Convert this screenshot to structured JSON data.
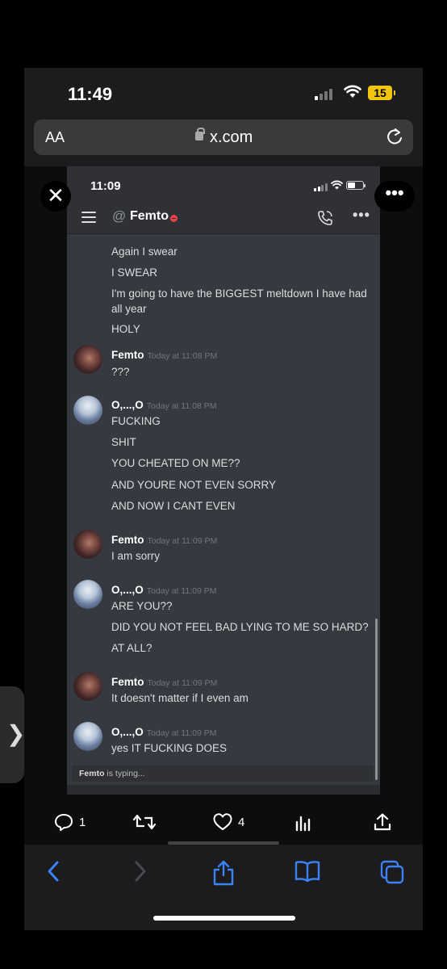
{
  "outer_status": {
    "time": "11:49",
    "battery": "15"
  },
  "browser": {
    "aa_label": "AA",
    "url": "x.com"
  },
  "discord": {
    "status_time": "11:09",
    "header_at": "@",
    "channel_name": "Femto",
    "messages": [
      {
        "type": "cont",
        "text": "Again I swear"
      },
      {
        "type": "cont",
        "text": "I SWEAR"
      },
      {
        "type": "cont",
        "text": "I'm going to have the BIGGEST meltdown I have had all year"
      },
      {
        "type": "cont",
        "text": "HOLY"
      },
      {
        "type": "head",
        "author": "Femto",
        "timestamp": "Today at 11:08 PM",
        "text": "???"
      },
      {
        "type": "head",
        "author": "O,...,O",
        "timestamp": "Today at 11:08 PM",
        "text": "FUCKING"
      },
      {
        "type": "cont",
        "text": "SHIT"
      },
      {
        "type": "cont",
        "text": "YOU CHEATED ON ME??"
      },
      {
        "type": "cont",
        "text": "AND YOURE NOT EVEN SORRY"
      },
      {
        "type": "cont",
        "text": "AND NOW I CANT EVEN"
      },
      {
        "type": "head",
        "author": "Femto",
        "timestamp": "Today at 11:09 PM",
        "text": "I am sorry"
      },
      {
        "type": "head",
        "author": "O,...,O",
        "timestamp": "Today at 11:09 PM",
        "text": "ARE YOU??"
      },
      {
        "type": "cont",
        "text": "DID YOU NOT FEEL BAD LYING TO ME SO HARD?"
      },
      {
        "type": "cont",
        "text": "AT ALL?"
      },
      {
        "type": "head",
        "author": "Femto",
        "timestamp": "Today at 11:09 PM",
        "text": "It doesn't matter if I even am"
      },
      {
        "type": "head",
        "author": "O,...,O",
        "timestamp": "Today at 11:09 PM",
        "text": "yes IT FUCKING DOES"
      }
    ],
    "typing_user": "Femto",
    "typing_suffix": " is typing..."
  },
  "tweet_actions": {
    "reply_count": "1",
    "like_count": "4"
  },
  "icons": [
    "close-icon",
    "more-icon",
    "menu-icon",
    "call-icon",
    "reply-icon",
    "retweet-icon",
    "like-icon",
    "analytics-icon",
    "share-icon",
    "back-icon",
    "forward-icon",
    "safari-share-icon",
    "bookmarks-icon",
    "tabs-icon",
    "reload-icon",
    "lock-icon"
  ]
}
